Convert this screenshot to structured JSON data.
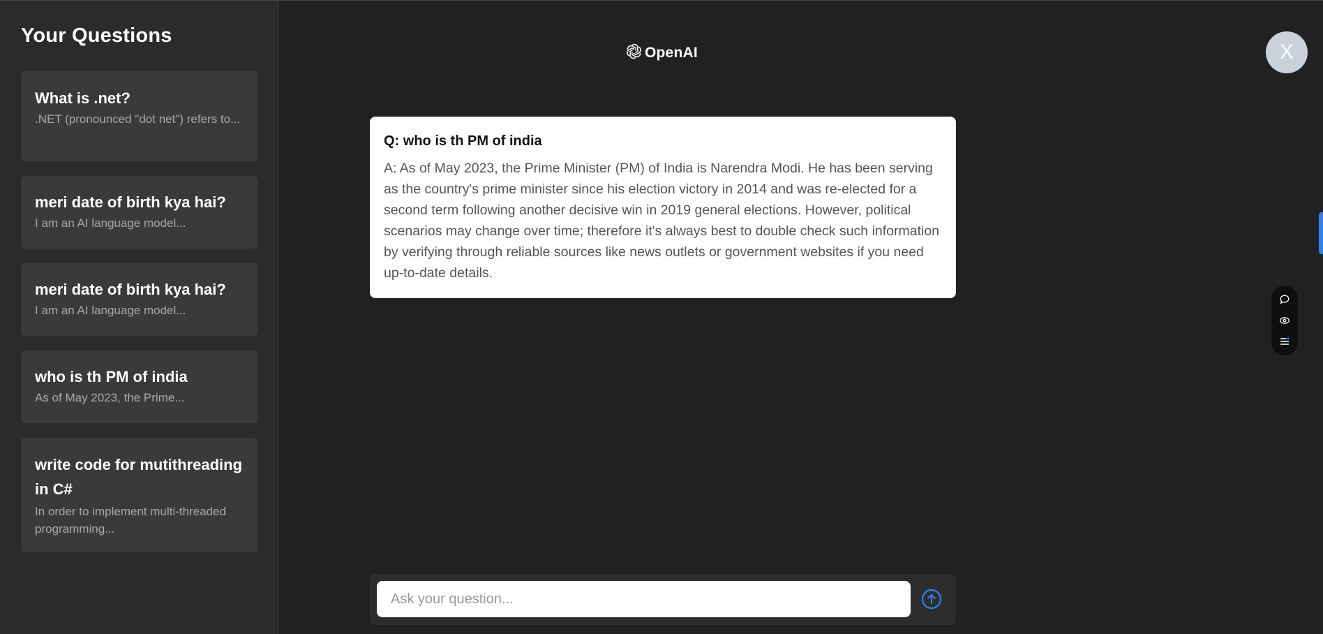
{
  "sidebar": {
    "title": "Your Questions",
    "items": [
      {
        "title": "What is .net?",
        "preview": ".NET (pronounced \"dot net\") refers to..."
      },
      {
        "title": "meri date of birth kya hai?",
        "preview": "I am an AI language model..."
      },
      {
        "title": "meri date of birth kya hai?",
        "preview": "I am an AI language model..."
      },
      {
        "title": "who is th PM of india",
        "preview": "As of May 2023, the Prime..."
      },
      {
        "title": "write code for mutithreading in C#",
        "preview": "In order to implement multi-threaded programming..."
      }
    ]
  },
  "header": {
    "logo_text": "OpenAI",
    "logo_icon": "openai-logo-icon"
  },
  "close_button": {
    "label": "X"
  },
  "answer": {
    "question": "Q: who is th PM of india",
    "text": "A: As of May 2023, the Prime Minister (PM) of India is Narendra Modi. He has been serving as the country's prime minister since his election victory in 2014 and was re-elected for a second term following another decisive win in 2019 general elections. However, political scenarios may change over time; therefore it's always best to double check such information by verifying through reliable sources like news outlets or government websites if you need up-to-date details."
  },
  "toolbar": {
    "icons": [
      "chat-bubble-icon",
      "eye-icon",
      "list-icon"
    ]
  },
  "input": {
    "placeholder": "Ask your question...",
    "value": ""
  },
  "colors": {
    "background": "#212121",
    "sidebar": "#2b2b2b",
    "card": "#3a3a3a",
    "accent": "#2f80ed"
  }
}
